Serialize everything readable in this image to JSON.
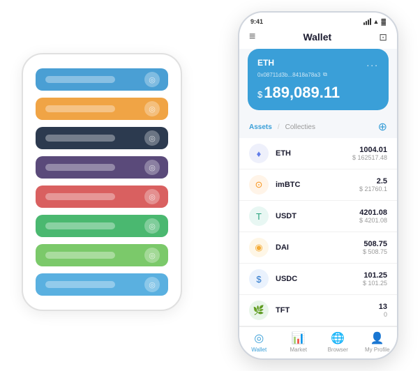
{
  "scene": {
    "bg_phone": {
      "cards": [
        {
          "id": "card-1",
          "color": "card-blue",
          "label": ""
        },
        {
          "id": "card-2",
          "color": "card-orange",
          "label": ""
        },
        {
          "id": "card-3",
          "color": "card-dark",
          "label": ""
        },
        {
          "id": "card-4",
          "color": "card-purple",
          "label": ""
        },
        {
          "id": "card-5",
          "color": "card-red",
          "label": ""
        },
        {
          "id": "card-6",
          "color": "card-green",
          "label": ""
        },
        {
          "id": "card-7",
          "color": "card-light-green",
          "label": ""
        },
        {
          "id": "card-8",
          "color": "card-light-blue",
          "label": ""
        }
      ]
    },
    "fg_phone": {
      "status_bar": {
        "time": "9:41",
        "battery": "●●●",
        "wifi": "▲",
        "signal": "|||"
      },
      "header": {
        "menu_label": "≡",
        "title": "Wallet",
        "scan_label": "⊡"
      },
      "wallet_card": {
        "coin_label": "ETH",
        "more_label": "...",
        "address": "0x08711d3b...8418a78a3",
        "copy_icon": "⧉",
        "balance_prefix": "$",
        "balance": "189,089.11"
      },
      "assets": {
        "tab_active": "Assets",
        "tab_divider": "/",
        "tab_inactive": "Collecties",
        "add_icon": "⊕",
        "items": [
          {
            "symbol": "ETH",
            "icon": "♦",
            "icon_color": "#627eea",
            "icon_bg": "#eef0fb",
            "amount": "1004.01",
            "usd": "$ 162517.48"
          },
          {
            "symbol": "imBTC",
            "icon": "⊙",
            "icon_color": "#f7931a",
            "icon_bg": "#fff4e8",
            "amount": "2.5",
            "usd": "$ 21760.1"
          },
          {
            "symbol": "USDT",
            "icon": "T",
            "icon_color": "#26a17b",
            "icon_bg": "#e8f7f3",
            "amount": "4201.08",
            "usd": "$ 4201.08"
          },
          {
            "symbol": "DAI",
            "icon": "◉",
            "icon_color": "#f5ac37",
            "icon_bg": "#fef6e6",
            "amount": "508.75",
            "usd": "$ 508.75"
          },
          {
            "symbol": "USDC",
            "icon": "$",
            "icon_color": "#2775ca",
            "icon_bg": "#eaf2fd",
            "amount": "101.25",
            "usd": "$ 101.25"
          },
          {
            "symbol": "TFT",
            "icon": "🌿",
            "icon_color": "#4caf50",
            "icon_bg": "#e8f5e9",
            "amount": "13",
            "usd": "0"
          }
        ]
      },
      "bottom_nav": {
        "items": [
          {
            "id": "wallet",
            "icon": "◎",
            "label": "Wallet",
            "active": true
          },
          {
            "id": "market",
            "icon": "📊",
            "label": "Market",
            "active": false
          },
          {
            "id": "browser",
            "icon": "🌐",
            "label": "Browser",
            "active": false
          },
          {
            "id": "profile",
            "icon": "👤",
            "label": "My Profile",
            "active": false
          }
        ]
      }
    }
  }
}
